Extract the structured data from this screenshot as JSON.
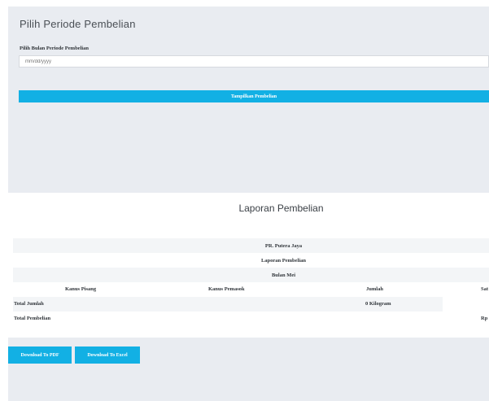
{
  "filter": {
    "title": "Pilih Periode Pembelian",
    "label": "Pilih Bulan Periode Pembelian",
    "month_placeholder": "mm/dd/yyyy",
    "show_button": "Tampilkan Pembelian"
  },
  "report": {
    "title": "Laporan Pembelian",
    "company": "PR. Putera Jaya",
    "subtitle": "Laporan Pembelian",
    "month": "Bulan Mei",
    "columns": [
      "Kanus Pisang",
      "Kanus Pemasok",
      "Jumlah",
      "Sat"
    ],
    "total_jumlah_label": "Total Jumlah",
    "total_jumlah_value": "0 Kilogram",
    "total_pembelian_label": "Total Pembelian",
    "total_pembelian_value": "Rp"
  },
  "actions": {
    "pdf_button": "Download To PDF",
    "excel_button": "Download To Excel"
  },
  "colors": {
    "accent": "#12b0e4",
    "page_bg": "#e9ecf1"
  }
}
